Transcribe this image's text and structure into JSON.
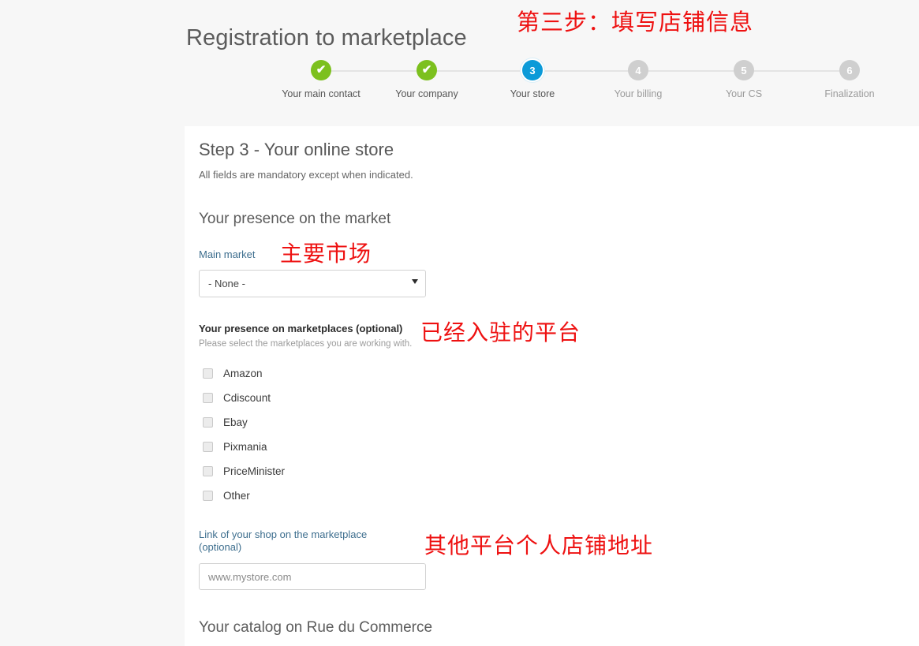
{
  "header": {
    "title": "Registration to marketplace"
  },
  "annotations": {
    "step3": "第三步：填写店铺信息",
    "main_market": "主要市场",
    "platforms": "已经入驻的平台",
    "shop_link": "其他平台个人店铺地址"
  },
  "stepper": {
    "steps": [
      {
        "marker": "✔",
        "label": "Your main contact",
        "state": "done"
      },
      {
        "marker": "✔",
        "label": "Your company",
        "state": "done"
      },
      {
        "marker": "3",
        "label": "Your store",
        "state": "current"
      },
      {
        "marker": "4",
        "label": "Your billing",
        "state": "todo"
      },
      {
        "marker": "5",
        "label": "Your CS",
        "state": "todo"
      },
      {
        "marker": "6",
        "label": "Finalization",
        "state": "todo"
      }
    ],
    "colors": {
      "done": "#7cc01e",
      "current": "#0b9ad8",
      "todo": "#cfcfcf"
    }
  },
  "form": {
    "step_heading": "Step 3 - Your online store",
    "mandatory_note": "All fields are mandatory except when indicated.",
    "presence_section_title": "Your presence on the market",
    "main_market": {
      "label": "Main market",
      "selected": "- None -"
    },
    "marketplaces": {
      "label": "Your presence on marketplaces (optional)",
      "help": "Please select the marketplaces you are working with.",
      "options": [
        {
          "label": "Amazon",
          "checked": false
        },
        {
          "label": "Cdiscount",
          "checked": false
        },
        {
          "label": "Ebay",
          "checked": false
        },
        {
          "label": "Pixmania",
          "checked": false
        },
        {
          "label": "PriceMinister",
          "checked": false
        },
        {
          "label": "Other",
          "checked": false
        }
      ]
    },
    "shop_link": {
      "label_line1": "Link of your shop on the marketplace",
      "label_line2": "(optional)",
      "placeholder": "www.mystore.com",
      "value": ""
    },
    "catalog_section_title": "Your catalog on Rue du Commerce"
  }
}
